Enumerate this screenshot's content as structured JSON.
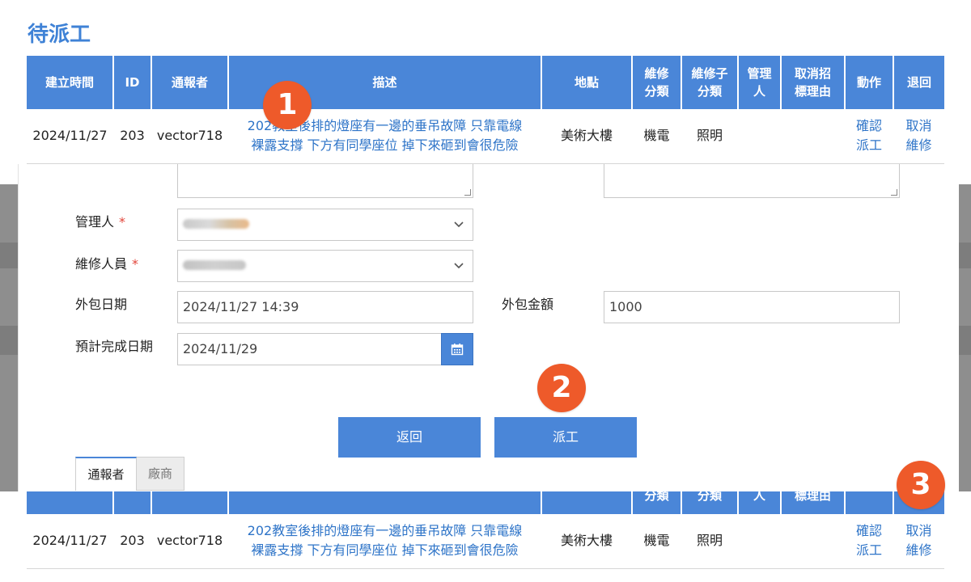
{
  "page": {
    "title": "待派工"
  },
  "table": {
    "headers": [
      "建立時間",
      "ID",
      "通報者",
      "描述",
      "地點",
      "維修\n分類",
      "維修子\n分類",
      "管理\n人",
      "取消招\n標理由",
      "動作",
      "退回"
    ],
    "header_parts": [
      [
        "建立時間"
      ],
      [
        "ID"
      ],
      [
        "通報者"
      ],
      [
        "描述"
      ],
      [
        "地點"
      ],
      [
        "維修",
        "分類"
      ],
      [
        "維修子",
        "分類"
      ],
      [
        "管理",
        "人"
      ],
      [
        "取消招",
        "標理由"
      ],
      [
        "動作"
      ],
      [
        "退回"
      ]
    ],
    "row": {
      "created": "2024/11/27",
      "id": "203",
      "reporter": "vector718",
      "description_line1": "202教室後排的燈座有一邊的垂吊故障 只靠電線",
      "description_line2": "裸露支撐 下方有同學座位 掉下來砸到會很危險",
      "location": "美術大樓",
      "category": "機電",
      "subcategory": "照明",
      "manager": "",
      "cancel_reason": "",
      "action_line1": "確認",
      "action_line2": "派工",
      "return_line1": "取消",
      "return_line2": "維修"
    }
  },
  "form": {
    "manager_label": "管理人",
    "technician_label": "維修人員",
    "required_mark": "*",
    "outsource_date_label": "外包日期",
    "outsource_date_value": "2024/11/27 14:39",
    "outsource_amount_label": "外包金額",
    "outsource_amount_value": "1000",
    "expected_date_label": "預計完成日期",
    "expected_date_value": "2024/11/29",
    "back_button": "返回",
    "dispatch_button": "派工"
  },
  "tabs": [
    {
      "label": "通報者",
      "active": true
    },
    {
      "label": "廠商",
      "active": false
    }
  ],
  "badges": [
    "1",
    "2",
    "3"
  ],
  "colors": {
    "accent": "#4a86d8",
    "link": "#2e74c8",
    "title": "#3f82d6",
    "badge": "#ee5a2a",
    "required": "#e2453a"
  },
  "icons": {
    "calendar": "calendar-icon",
    "chevron": "chevron-down-icon"
  }
}
